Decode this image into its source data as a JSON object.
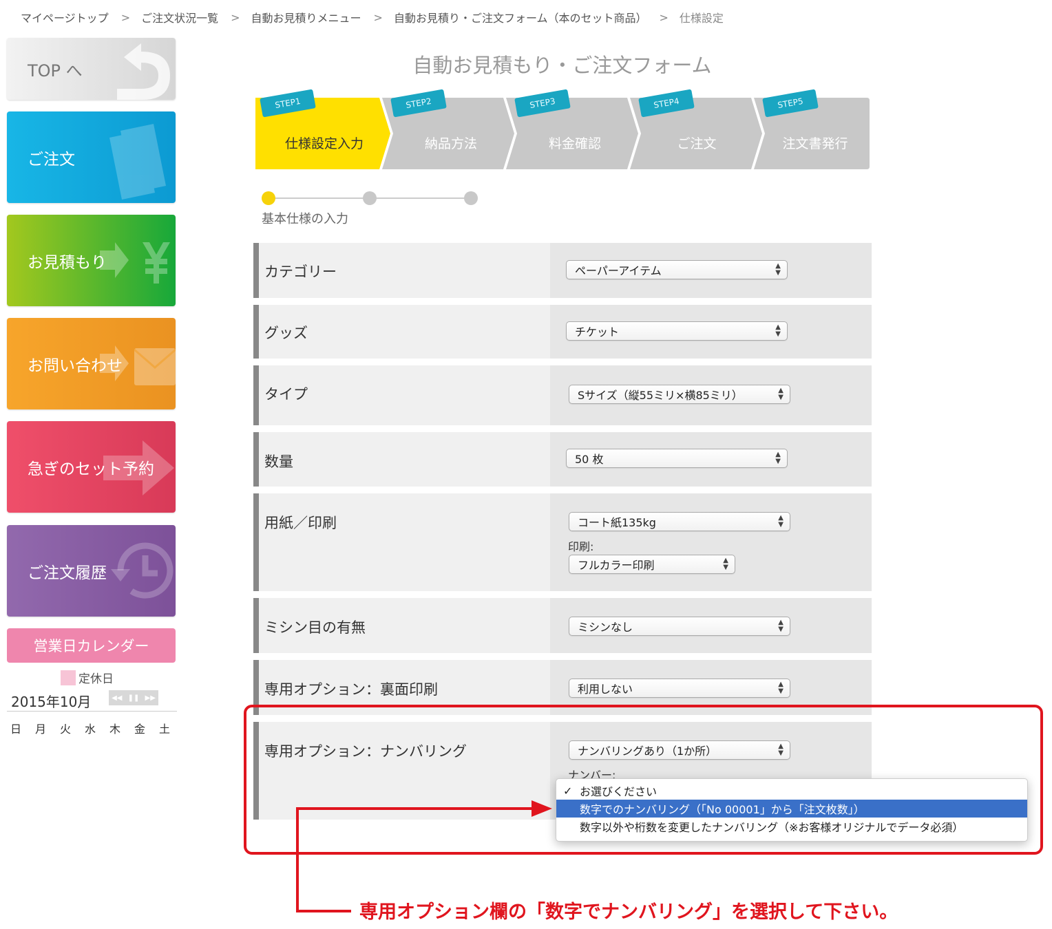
{
  "breadcrumb": [
    "マイページトップ",
    "ご注文状況一覧",
    "自動お見積りメニュー",
    "自動お見積り・ご注文フォーム（本のセット商品）",
    "仕様設定"
  ],
  "breadcrumb_separator": ">",
  "sidebar": {
    "top_label": "TOP へ",
    "order_label": "ご注文",
    "quote_label": "お見積もり",
    "contact_label": "お問い合わせ",
    "rush_label": "急ぎのセット予約",
    "history_label": "ご注文履歴",
    "calendar_button": "営業日カレンダー",
    "holiday_legend": "定休日",
    "calendar_month": "2015年10月",
    "weekdays": [
      "日",
      "月",
      "火",
      "水",
      "木",
      "金",
      "土"
    ]
  },
  "page_title": "自動お見積もり・ご注文フォーム",
  "steps": [
    {
      "tag": "STEP1",
      "label": "仕様設定入力"
    },
    {
      "tag": "STEP2",
      "label": "納品方法"
    },
    {
      "tag": "STEP3",
      "label": "料金確認"
    },
    {
      "tag": "STEP4",
      "label": "ご注文"
    },
    {
      "tag": "STEP5",
      "label": "注文書発行"
    }
  ],
  "active_step": 0,
  "substep_label": "基本仕様の入力",
  "form": {
    "category": {
      "label": "カテゴリー",
      "value": "ペーパーアイテム"
    },
    "goods": {
      "label": "グッズ",
      "value": "チケット"
    },
    "type": {
      "label": "タイプ",
      "value": "Sサイズ（縦55ミリ×横85ミリ）"
    },
    "quantity": {
      "label": "数量",
      "value": "50 枚"
    },
    "paper": {
      "label": "用紙／印刷",
      "value": "コート紙135kg",
      "print_label": "印刷:",
      "print_value": "フルカラー印刷"
    },
    "perforation": {
      "label": "ミシン目の有無",
      "value": "ミシンなし"
    },
    "back_print": {
      "label": "専用オプション：裏面印刷",
      "value": "利用しない"
    },
    "numbering": {
      "label": "専用オプション：ナンバリング",
      "value": "ナンバリングあり（1か所）",
      "number_label": "ナンバー:"
    }
  },
  "dropdown": {
    "options": [
      "お選びください",
      "数字でのナンバリング（「No 00001」から「注文枚数」）",
      "数字以外や桁数を変更したナンバリング（※お客様オリジナルでデータ必須）"
    ],
    "checked_index": 0,
    "highlighted_index": 1,
    "check_mark": "✓"
  },
  "annotation": {
    "text": "専用オプション欄の「数字でナンバリング」を選択して下さい。",
    "color": "#e0151e"
  },
  "colors": {
    "active_step": "#ffe000",
    "inactive_step": "#c8c8c8",
    "step_tag": "#1aa6c2",
    "highlight": "#3a70c8"
  }
}
